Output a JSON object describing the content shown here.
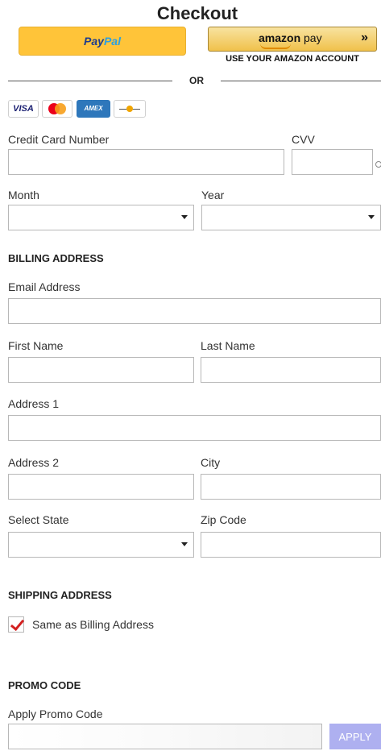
{
  "header": {
    "title": "Checkout"
  },
  "payments": {
    "paypal": {
      "pay": "Pay",
      "pal": "Pal"
    },
    "amazon": {
      "logo_bold": "amazon",
      "logo_rest": " pay",
      "arrows": "»",
      "subtitle": "USE YOUR AMAZON ACCOUNT"
    },
    "or": "OR",
    "cards": {
      "visa": "VISA",
      "amex": "AMEX"
    }
  },
  "card_fields": {
    "number_label": "Credit Card Number",
    "cvv_label": "CVV",
    "month_label": "Month",
    "year_label": "Year"
  },
  "billing": {
    "section_title": "BILLING ADDRESS",
    "email_label": "Email Address",
    "first_name_label": "First Name",
    "last_name_label": "Last Name",
    "address1_label": "Address 1",
    "address2_label": "Address 2",
    "city_label": "City",
    "state_label": "Select State",
    "zip_label": "Zip Code"
  },
  "shipping": {
    "section_title": "SHIPPING ADDRESS",
    "same_as_billing_label": "Same as Billing Address",
    "same_as_billing_checked": true
  },
  "promo": {
    "section_title": "PROMO CODE",
    "label": "Apply Promo Code",
    "apply_label": "APPLY"
  },
  "colors": {
    "paypal_yellow": "#ffc439",
    "amazon_gold": "#f0c14b",
    "check_red": "#d32020",
    "apply_button": "#aeb0f0"
  }
}
